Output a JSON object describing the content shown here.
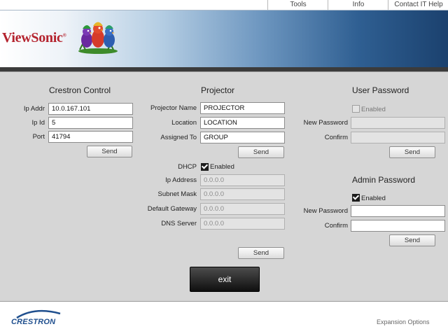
{
  "nav": {
    "tools": "Tools",
    "info": "Info",
    "help": "Contact IT Help"
  },
  "brand": {
    "logo_text": "ViewSonic",
    "reg": "®",
    "footer_logo": "CRESTRON"
  },
  "crestron_control": {
    "title": "Crestron Control",
    "ip_addr_label": "Ip Addr",
    "ip_addr": "10.0.167.101",
    "ip_id_label": "Ip Id",
    "ip_id": "5",
    "port_label": "Port",
    "port": "41794",
    "send": "Send"
  },
  "projector": {
    "title": "Projector",
    "name_label": "Projector Name",
    "name": "PROJECTOR",
    "location_label": "Location",
    "location": "LOCATION",
    "assigned_label": "Assigned To",
    "assigned": "GROUP",
    "send": "Send",
    "dhcp_label": "DHCP",
    "dhcp_enabled": "Enabled",
    "ip_label": "Ip Address",
    "ip": "0.0.0.0",
    "subnet_label": "Subnet Mask",
    "subnet": "0.0.0.0",
    "gateway_label": "Default Gateway",
    "gateway": "0.0.0.0",
    "dns_label": "DNS Server",
    "dns": "0.0.0.0",
    "send2": "Send"
  },
  "user_password": {
    "title": "User Password",
    "enabled": "Enabled",
    "new_label": "New Password",
    "confirm_label": "Confirm",
    "send": "Send"
  },
  "admin_password": {
    "title": "Admin Password",
    "enabled": "Enabled",
    "new_label": "New Password",
    "confirm_label": "Confirm",
    "send": "Send"
  },
  "exit": "exit",
  "footer": {
    "expansion": "Expansion Options"
  },
  "colors": {
    "brand_red": "#b4232e",
    "banner_dark": "#1b416e",
    "panel": "#d6d6d6",
    "crestron_blue": "#1f4f8e"
  },
  "icons": {
    "logo_birds": "viewsonic-birds-icon",
    "crestron_swoosh": "crestron-swoosh-icon"
  }
}
